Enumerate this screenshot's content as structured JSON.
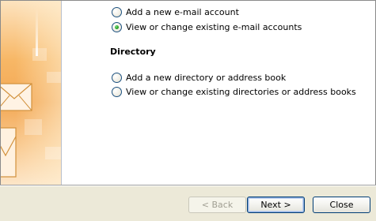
{
  "email_options": [
    {
      "label": "Add a new e-mail account",
      "selected": false
    },
    {
      "label": "View or change existing e-mail accounts",
      "selected": true
    }
  ],
  "directory": {
    "title": "Directory",
    "options": [
      {
        "label": "Add a new directory or address book",
        "selected": false
      },
      {
        "label": "View or change existing directories or address books",
        "selected": false
      }
    ]
  },
  "buttons": {
    "back": "< Back",
    "next": "Next >",
    "close": "Close"
  },
  "colors": {
    "banner": "#f3a855",
    "footer": "#ece9d8",
    "radio_selected": "#21a121",
    "button_border": "#003c74"
  }
}
